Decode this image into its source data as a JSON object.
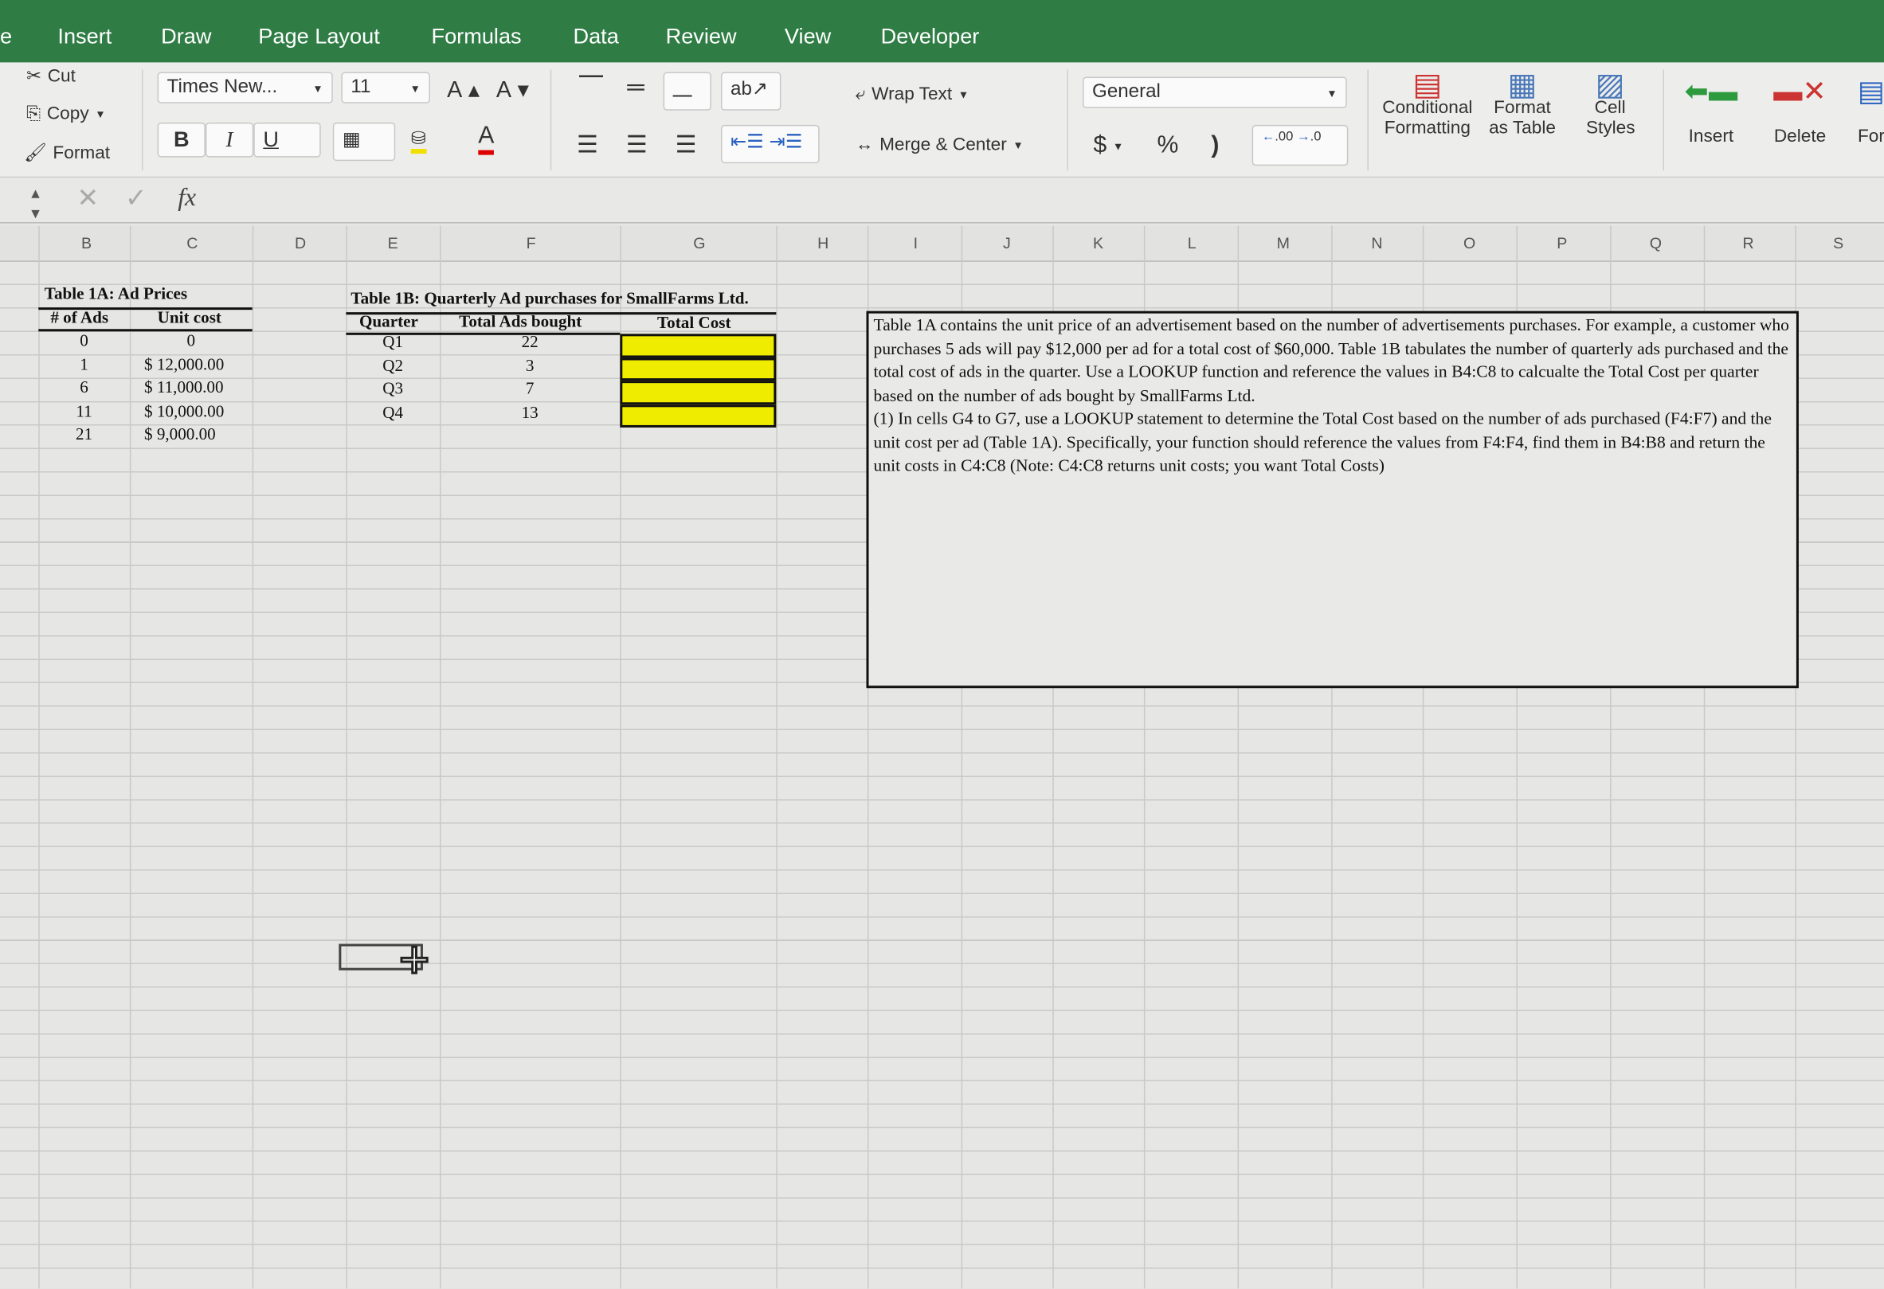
{
  "ribbon_tabs": [
    "e",
    "Insert",
    "Draw",
    "Page Layout",
    "Formulas",
    "Data",
    "Review",
    "View",
    "Developer"
  ],
  "clipboard": {
    "cut": "Cut",
    "copy": "Copy",
    "format": "Format"
  },
  "font": {
    "name": "Times New...",
    "size": "11",
    "bold": "B",
    "italic": "I",
    "underline": "U",
    "grow": "A",
    "shrink": "A",
    "color": "A"
  },
  "alignment": {
    "wrap_text": "Wrap Text",
    "merge_center": "Merge & Center"
  },
  "number": {
    "format": "General",
    "currency": "$",
    "percent": "%",
    "comma": ")",
    "inc_decimal": ".00",
    "dec_decimal": ".0"
  },
  "styles": {
    "conditional": "Conditional Formatting",
    "format_table": "Format as Table",
    "cell_styles": "Cell Styles"
  },
  "cells_group": {
    "insert": "Insert",
    "delete": "Delete",
    "format": "For"
  },
  "formula_bar": {
    "fx": "fx",
    "value": ""
  },
  "columns": [
    "B",
    "C",
    "D",
    "E",
    "F",
    "G",
    "H",
    "I",
    "J",
    "K",
    "L",
    "M",
    "N",
    "O",
    "P",
    "Q",
    "R",
    "S"
  ],
  "table1a": {
    "title": "Table 1A: Ad Prices",
    "headers": [
      "# of Ads",
      "Unit cost"
    ],
    "rows": [
      [
        "0",
        "0"
      ],
      [
        "1",
        "$ 12,000.00"
      ],
      [
        "6",
        "$ 11,000.00"
      ],
      [
        "11",
        "$ 10,000.00"
      ],
      [
        "21",
        "$  9,000.00"
      ]
    ]
  },
  "table1b": {
    "title": "Table 1B: Quarterly Ad purchases for SmallFarms Ltd.",
    "headers": [
      "Quarter",
      "Total Ads bought",
      "Total Cost"
    ],
    "rows": [
      [
        "Q1",
        "22",
        ""
      ],
      [
        "Q2",
        "3",
        ""
      ],
      [
        "Q3",
        "7",
        ""
      ],
      [
        "Q4",
        "13",
        ""
      ]
    ],
    "highlight_color": "#f0ec00"
  },
  "note": "Table 1A contains the unit price of an advertisement based on the number of advertisements purchases. For example, a customer who purchases 5 ads will pay $12,000 per ad for a total cost of $60,000. Table 1B tabulates the number of quarterly ads purchased and the total cost of ads in the quarter. Use a LOOKUP function and reference the values in B4:C8 to calcualte the Total Cost per quarter based on the number of ads bought by SmallFarms Ltd.",
  "note2": "(1) In cells G4 to G7, use a LOOKUP statement to determine the Total Cost based on the number of ads purchased (F4:F7) and the unit cost per ad (Table 1A). Specifically, your function should reference the values from F4:F4, find them in B4:B8 and return the unit costs in C4:C8 (Note: C4:C8 returns unit costs; you want Total Costs)"
}
